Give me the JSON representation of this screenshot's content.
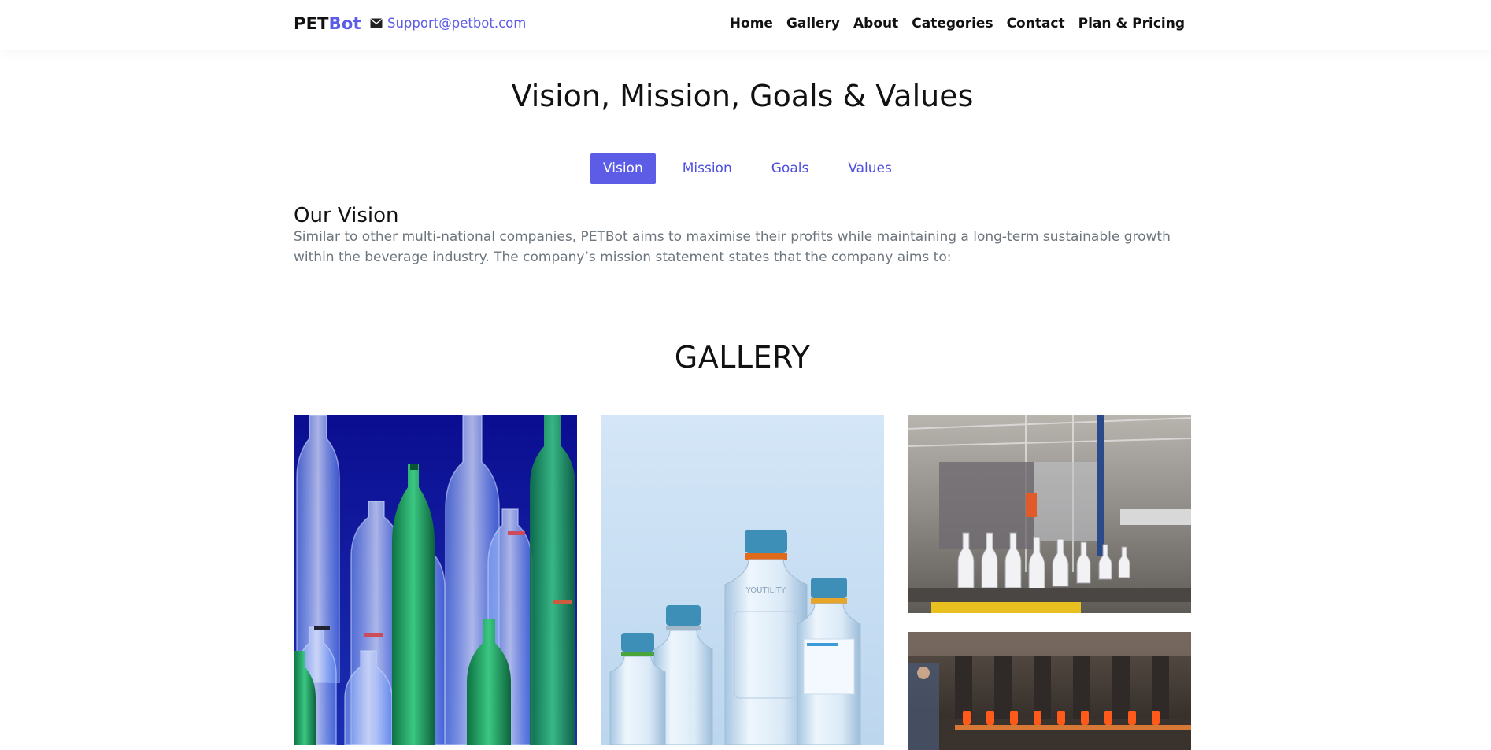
{
  "brand": {
    "prefix": "PET",
    "accent": "Bot"
  },
  "support": {
    "email": "Support@petbot.com",
    "icon": "envelope-icon"
  },
  "nav": [
    {
      "label": "Home"
    },
    {
      "label": "Gallery"
    },
    {
      "label": "About"
    },
    {
      "label": "Categories"
    },
    {
      "label": "Contact"
    },
    {
      "label": "Plan & Pricing"
    }
  ],
  "vision_section": {
    "title": "Vision, Mission, Goals & Values",
    "tabs": [
      {
        "label": "Vision",
        "active": true
      },
      {
        "label": "Mission",
        "active": false
      },
      {
        "label": "Goals",
        "active": false
      },
      {
        "label": "Values",
        "active": false
      }
    ],
    "heading": "Our Vision",
    "text": "Similar to other multi-national companies, PETBot aims to maximise their profits while maintaining a long-term sustainable growth within the beverage industry. The company’s mission statement states that the company aims to:"
  },
  "gallery": {
    "title": "GALLERY",
    "images": [
      {
        "subject": "assorted plastic bottles on blue background"
      },
      {
        "subject": "laboratory glass bottles with blue caps",
        "label": "YOUTILITY"
      },
      {
        "subject": "bottling production line"
      },
      {
        "subject": "glass bottle manufacturing furnace line"
      }
    ]
  },
  "colors": {
    "accent": "#5c5ce6",
    "text": "#111111",
    "muted": "#6c757d"
  }
}
